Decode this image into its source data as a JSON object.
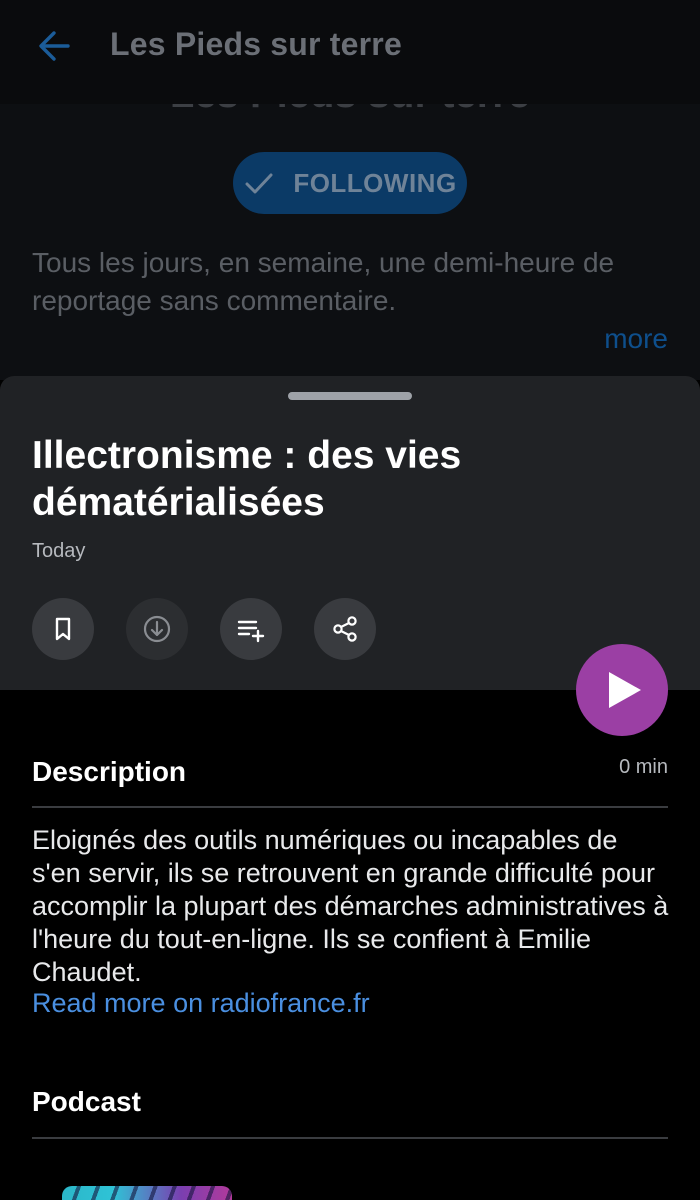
{
  "background": {
    "appbar_title": "Les Pieds sur terre",
    "big_title": "Les Pieds sur terre",
    "follow_label": "FOLLOWING",
    "description": "Tous les jours, en semaine, une demi-heure de reportage sans commentaire.",
    "more_label": "more"
  },
  "episode": {
    "title": "Illectronisme : des vies dématérialisées",
    "date": "Today",
    "duration": "0 min",
    "actions": [
      "bookmark-icon",
      "download-icon",
      "add-to-queue-icon",
      "share-icon"
    ]
  },
  "description_section": {
    "title": "Description",
    "text": "Eloignés des outils numériques ou incapables de s'en servir, ils se retrouvent en grande difficulté pour accomplir la plupart des démarches administratives à l'heure du tout-en-ligne. Ils se confient à Emilie Chaudet.",
    "read_more": "Read more on radiofrance.fr"
  },
  "podcast_section": {
    "title": "Podcast"
  },
  "colors": {
    "accent_play": "#9b3fa4",
    "link": "#4a8fe0",
    "sheet_header": "#202225"
  }
}
